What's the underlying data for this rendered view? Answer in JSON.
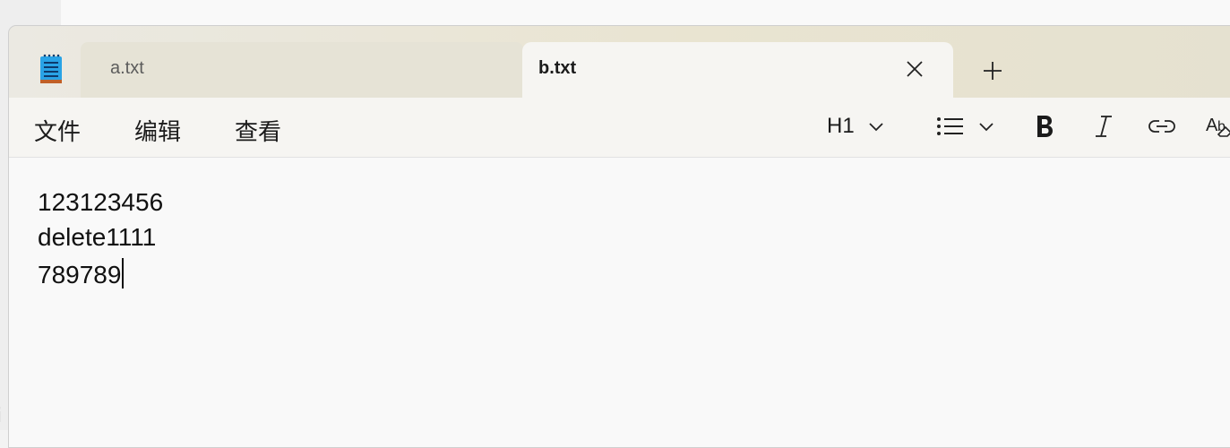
{
  "app": {
    "name": "Notepad",
    "icon": "notepad-icon"
  },
  "tabs": [
    {
      "label": "a.txt",
      "active": false
    },
    {
      "label": "b.txt",
      "active": true
    }
  ],
  "tab_close_icon": "close-icon",
  "new_tab_icon": "plus-icon",
  "menu": {
    "file": "文件",
    "edit": "编辑",
    "view": "查看"
  },
  "toolbar": {
    "heading": "H1",
    "heading_icon": "chevron-down-icon",
    "list_icon": "bullet-list-icon",
    "bold_icon": "bold-icon",
    "italic_icon": "italic-icon",
    "link_icon": "link-icon",
    "clear_format_icon": "clear-formatting-icon"
  },
  "document": {
    "lines": [
      "123123456",
      "delete1111",
      "789789"
    ]
  },
  "colors": {
    "accent": "#1e88e5",
    "titlebar": "#e9e4d1",
    "active_tab": "#f6f5f2",
    "editor_bg": "#f9f9f9"
  }
}
